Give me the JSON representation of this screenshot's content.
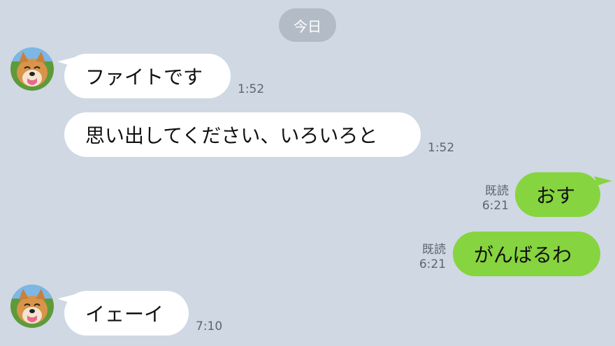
{
  "date_separator": "今日",
  "avatar_icon": "shiba-dog-avatar-icon",
  "messages": [
    {
      "side": "in",
      "text": "ファイトです",
      "time": "1:52",
      "avatar": true
    },
    {
      "side": "in",
      "text": "思い出してください、いろいろと",
      "time": "1:52",
      "avatar": false
    },
    {
      "side": "out",
      "text": "おす",
      "read": "既読",
      "time": "6:21"
    },
    {
      "side": "out",
      "text": "がんばるわ",
      "read": "既読",
      "time": "6:21"
    },
    {
      "side": "in",
      "text": "イェーイ",
      "time": "7:10",
      "avatar": true
    }
  ],
  "colors": {
    "background": "#cfd8e3",
    "incoming_bubble": "#ffffff",
    "outgoing_bubble": "#86d43f",
    "date_pill": "#b3bcc6",
    "meta_text": "#5c6673"
  }
}
